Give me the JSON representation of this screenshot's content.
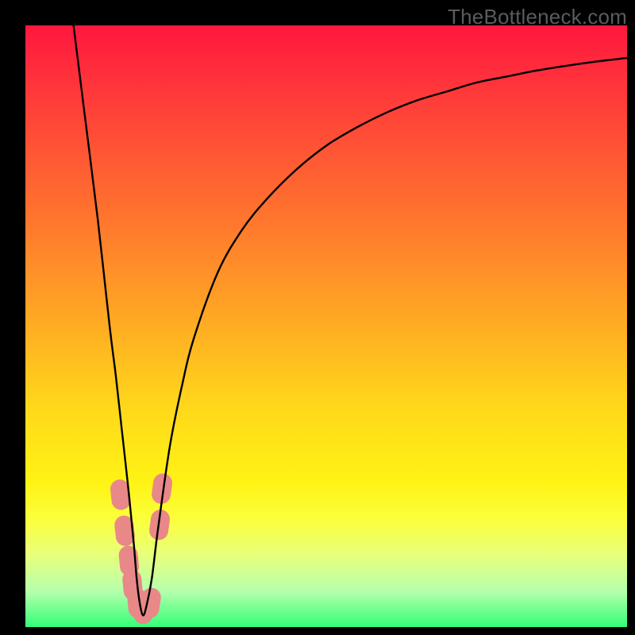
{
  "watermark": "TheBottleneck.com",
  "chart_data": {
    "type": "line",
    "title": "",
    "xlabel": "",
    "ylabel": "",
    "xlim": [
      0,
      100
    ],
    "ylim": [
      0,
      100
    ],
    "x": [
      8,
      10,
      12,
      14,
      15,
      16,
      17,
      18,
      18.5,
      19,
      19.5,
      20,
      21,
      22,
      24,
      26,
      28,
      32,
      36,
      40,
      45,
      50,
      55,
      60,
      65,
      70,
      75,
      80,
      85,
      90,
      95,
      100
    ],
    "values": [
      100,
      84,
      68,
      50,
      42,
      33,
      24,
      14,
      8,
      4,
      2,
      3,
      8,
      16,
      30,
      40,
      48,
      59,
      66,
      71,
      76,
      80,
      83,
      85.5,
      87.5,
      89,
      90.5,
      91.5,
      92.5,
      93.3,
      94,
      94.6
    ],
    "markers": [
      {
        "x": 15.8,
        "y": 22
      },
      {
        "x": 16.5,
        "y": 16
      },
      {
        "x": 17.2,
        "y": 11
      },
      {
        "x": 17.8,
        "y": 7
      },
      {
        "x": 18.6,
        "y": 4
      },
      {
        "x": 19.8,
        "y": 3
      },
      {
        "x": 20.8,
        "y": 4
      },
      {
        "x": 22.3,
        "y": 17
      },
      {
        "x": 22.7,
        "y": 23
      }
    ],
    "marker_color": "#e98888",
    "marker_radius": 12
  }
}
